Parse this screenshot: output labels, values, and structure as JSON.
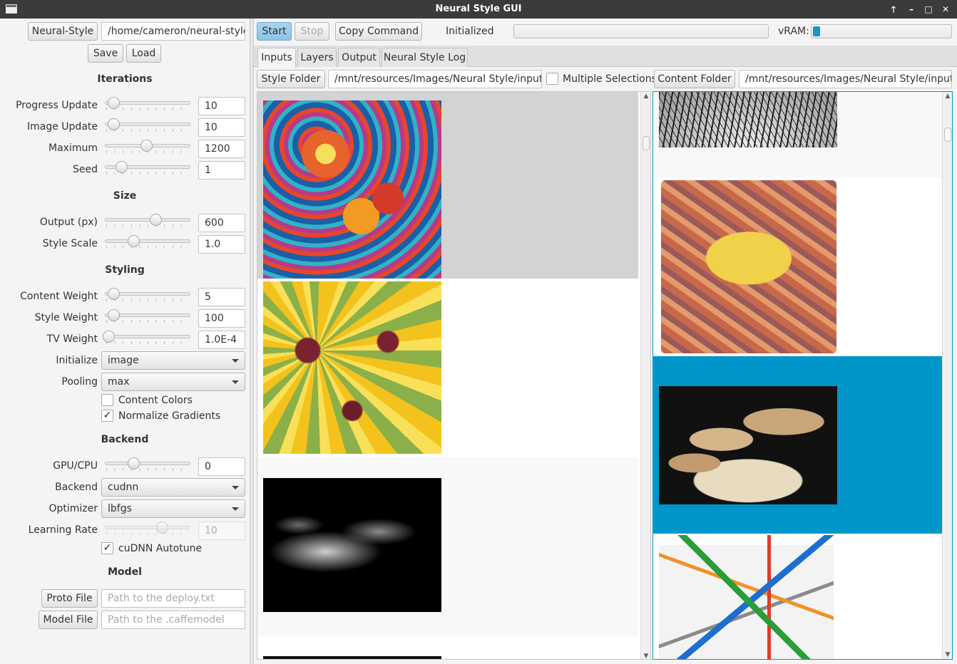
{
  "window": {
    "title": "Neural Style GUI",
    "buttons": [
      "🡑",
      "–",
      "□",
      "✕"
    ]
  },
  "left": {
    "neural_style_button": "Neural-Style",
    "neural_style_path": "/home/cameron/neural-style",
    "save_label": "Save",
    "load_label": "Load",
    "sections": {
      "iterations": "Iterations",
      "size": "Size",
      "styling": "Styling",
      "backend": "Backend",
      "model": "Model"
    },
    "progress_update": {
      "label": "Progress Update",
      "value": "10"
    },
    "image_update": {
      "label": "Image Update",
      "value": "10"
    },
    "maximum": {
      "label": "Maximum",
      "value": "1200"
    },
    "seed": {
      "label": "Seed",
      "value": "1"
    },
    "output_px": {
      "label": "Output (px)",
      "value": "600"
    },
    "style_scale": {
      "label": "Style Scale",
      "value": "1.0"
    },
    "content_weight": {
      "label": "Content Weight",
      "value": "5"
    },
    "style_weight": {
      "label": "Style Weight",
      "value": "100"
    },
    "tv_weight": {
      "label": "TV Weight",
      "value": "1.0E-4"
    },
    "initialize": {
      "label": "Initialize",
      "value": "image"
    },
    "pooling": {
      "label": "Pooling",
      "value": "max"
    },
    "content_colors": {
      "label": "Content Colors",
      "checked": false
    },
    "normalize_gradients": {
      "label": "Normalize Gradients",
      "checked": true
    },
    "gpu_cpu": {
      "label": "GPU/CPU",
      "value": "0"
    },
    "backend": {
      "label": "Backend",
      "value": "cudnn"
    },
    "optimizer": {
      "label": "Optimizer",
      "value": "lbfgs"
    },
    "learning_rate": {
      "label": "Learning Rate",
      "value": "10"
    },
    "cudnn_autotune": {
      "label": "cuDNN Autotune",
      "checked": true
    },
    "proto_file": {
      "label": "Proto File",
      "placeholder": "Path to the deploy.txt"
    },
    "model_file": {
      "label": "Model File",
      "placeholder": "Path to the .caffemodel"
    },
    "check_glyph": "✓"
  },
  "toolbar": {
    "start": "Start",
    "stop": "Stop",
    "copy_command": "Copy Command",
    "status": "Initialized",
    "vram_label": "vRAM:",
    "vram_fraction": 0.03,
    "progress_fraction": 0
  },
  "tabs": [
    "Inputs",
    "Layers",
    "Output",
    "Neural Style Log"
  ],
  "inputs": {
    "style_folder_button": "Style Folder",
    "style_folder_path": "/mnt/resources/Images/Neural Style/input",
    "multiple_selections": "Multiple Selections",
    "content_folder_button": "Content Folder",
    "content_folder_path": "/mnt/resources/Images/Neural Style/input"
  },
  "colors": {
    "accent": "#0096c9",
    "selected_style_row": "#d3d3d3"
  }
}
